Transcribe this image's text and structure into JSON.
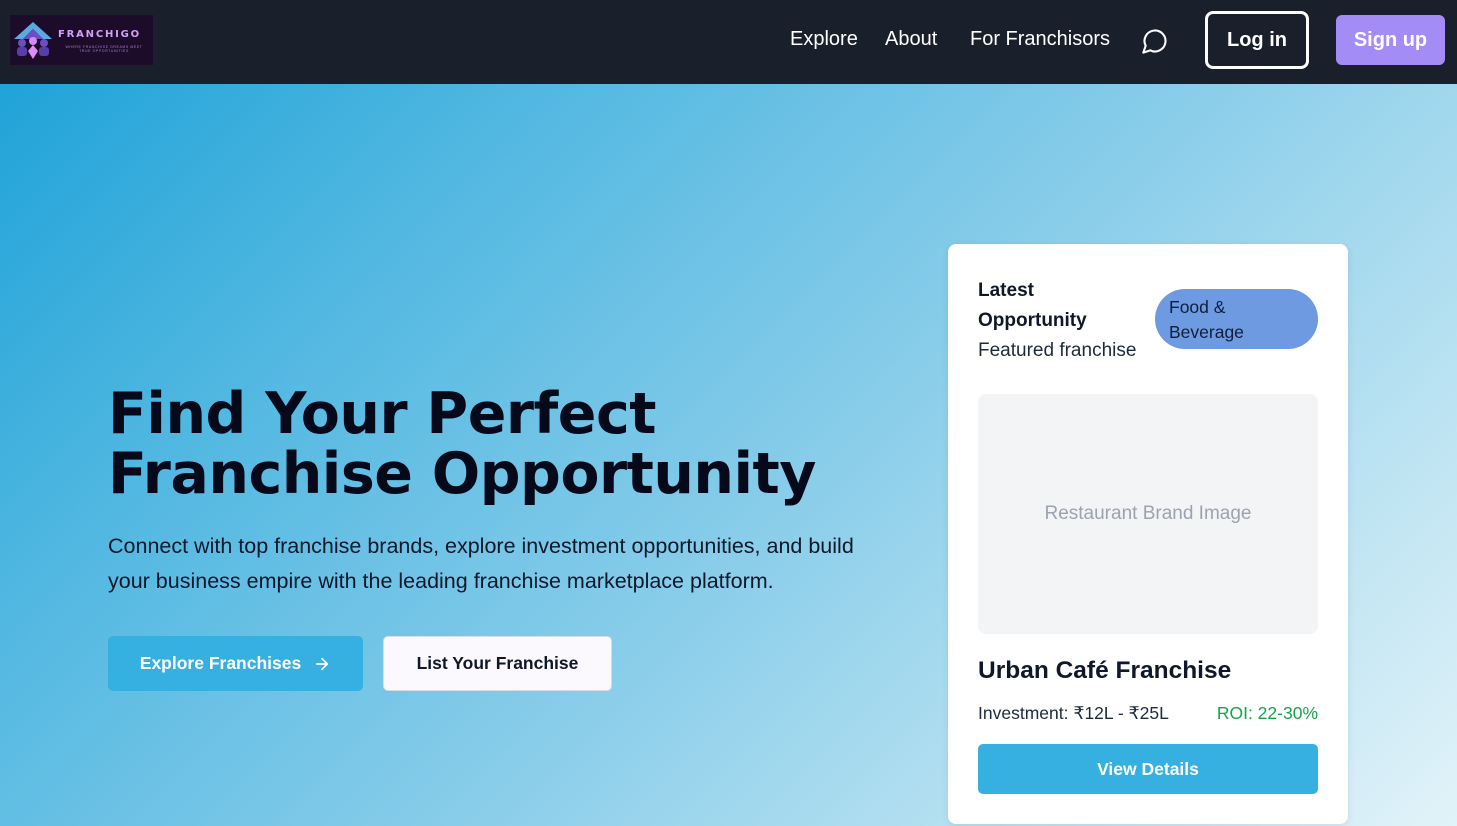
{
  "brand": {
    "name": "FRANCHIGO",
    "tagline": "WHERE FRANCHISE DREAMS MEET TRUE OPPORTUNITIES"
  },
  "nav": {
    "links": [
      "Explore",
      "About",
      "For Franchisors"
    ],
    "chat_icon": "message-circle-icon",
    "login_label": "Log in",
    "signup_label": "Sign up"
  },
  "hero": {
    "title": "Find Your Perfect Franchise Opportunity",
    "subtitle": "Connect with top franchise brands, explore investment opportunities, and build your business empire with the leading franchise marketplace platform.",
    "primary_button": "Explore Franchises",
    "primary_icon": "arrow-right-icon",
    "secondary_button": "List Your Franchise"
  },
  "card": {
    "label": "Latest Opportunity",
    "sublabel": "Featured franchise",
    "badge": "Food & Beverage",
    "image_placeholder": "Restaurant Brand Image",
    "title": "Urban Café Franchise",
    "investment": "Investment: ₹12L - ₹25L",
    "roi": "ROI: 22-30%",
    "button": "View Details"
  },
  "colors": {
    "navbar_bg": "#1a1f2c",
    "primary": "#36b0e0",
    "signup": "#a38cf5",
    "badge": "#6d9ae0",
    "roi": "#16a34a"
  }
}
